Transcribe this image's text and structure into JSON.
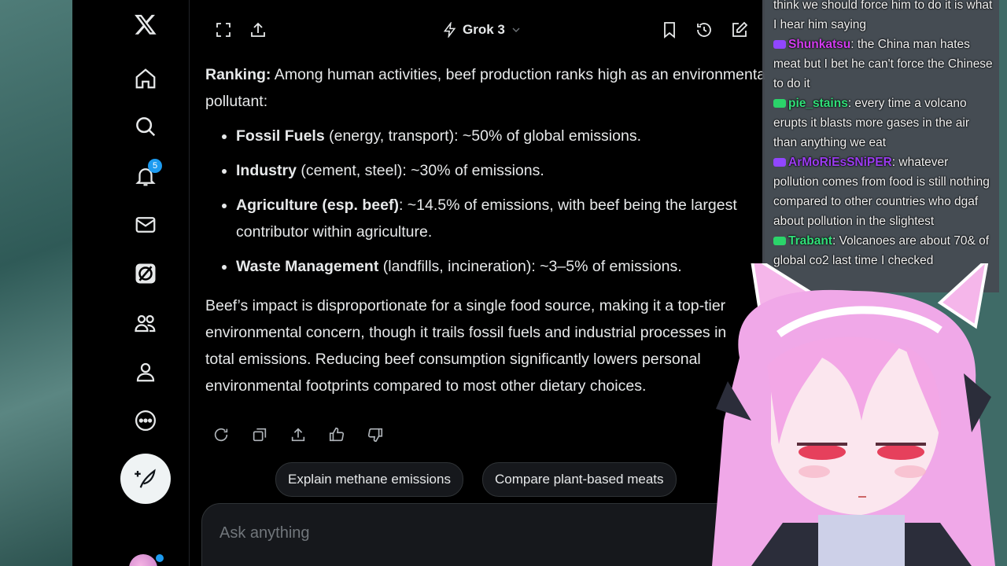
{
  "sidebar": {
    "notification_count": "5"
  },
  "topbar": {
    "model_name": "Grok 3"
  },
  "response": {
    "intro_label": "Ranking:",
    "intro_text": " Among human activities, beef production ranks high as an environmental pollutant:",
    "items": [
      {
        "label": "Fossil Fuels",
        "text": " (energy, transport): ~50% of global emissions."
      },
      {
        "label": "Industry",
        "text": " (cement, steel): ~30% of emissions."
      },
      {
        "label": "Agriculture (esp. beef)",
        "text": ": ~14.5% of emissions, with beef being the largest contributor within agriculture."
      },
      {
        "label": "Waste Management",
        "text": " (landfills, incineration): ~3–5% of emissions."
      }
    ],
    "summary": "Beef’s impact is disproportionate for a single food source, making it a top-tier environmental concern, though it trails fossil fuels and industrial processes in total emissions. Reducing beef consumption significantly lowers personal environmental footprints compared to most other dietary choices."
  },
  "suggestions": [
    "Explain methane emissions",
    "Compare plant-based meats"
  ],
  "input": {
    "placeholder": "Ask anything"
  },
  "stream_chat": {
    "messages": [
      {
        "user": "",
        "text": "think we should force him to do it is what I hear him saying",
        "user_color": "#ffffff",
        "platform_color": ""
      },
      {
        "user": "Shunkatsu",
        "text": ": the China man hates meat but I bet he can't force the Chinese to do it",
        "user_color": "#d33cf0",
        "platform_color": "#9146ff"
      },
      {
        "user": "pie_stains",
        "text": ": every time a volcano erupts it blasts more gases in the air than anything we eat",
        "user_color": "#31e07a",
        "platform_color": "#2bd46a"
      },
      {
        "user": "ArMoRiEsSNiPER",
        "text": ": whatever pollution comes from food is still nothing compared to other countries who dgaf about pollution in the slightest",
        "user_color": "#9b3cf0",
        "platform_color": "#9146ff"
      },
      {
        "user": "Trabant",
        "text": ": Volcanoes are about 70& of global co2 last time I checked",
        "user_color": "#31e07a",
        "platform_color": "#2bd46a"
      }
    ]
  },
  "colors": {
    "accent": "#1d9bf0",
    "background": "#000000",
    "text": "#e7e9ea",
    "muted": "#71767b"
  }
}
